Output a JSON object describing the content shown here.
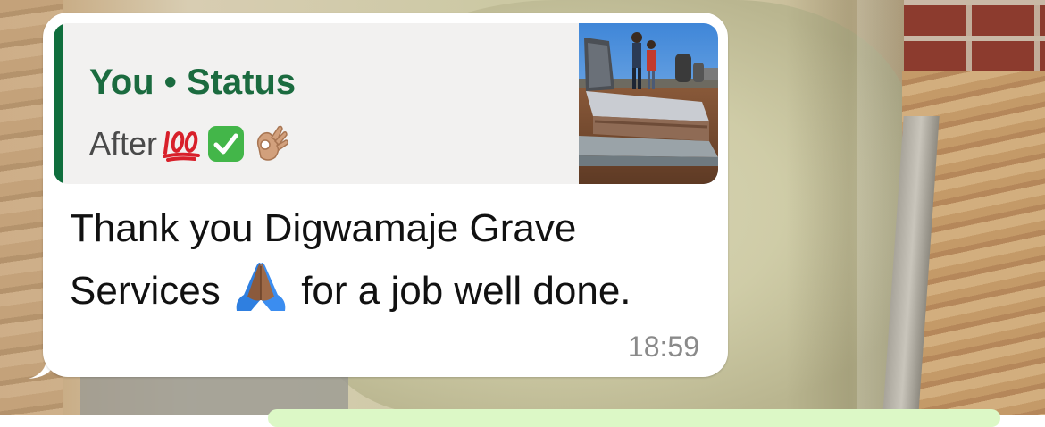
{
  "message": {
    "quoted_status": {
      "author": "You",
      "separator": "•",
      "label": "Status",
      "caption": "After",
      "caption_emojis": [
        "hundred-points-icon",
        "check-mark-button-icon",
        "ok-hand-icon"
      ]
    },
    "text_line1": "Thank you Digwamaje Grave",
    "text_line2_before_emoji": "Services",
    "text_emoji": "folded-hands-icon",
    "text_line2_after_emoji": "for a job well done.",
    "time": "18:59"
  },
  "colors": {
    "bubble": "#ffffff",
    "quote_background": "#f2f1f0",
    "quote_accent": "#0f6e3d",
    "quote_title": "#1b6b3f",
    "timestamp": "#8a8a8a",
    "outgoing_bubble": "#dcf8c6"
  }
}
